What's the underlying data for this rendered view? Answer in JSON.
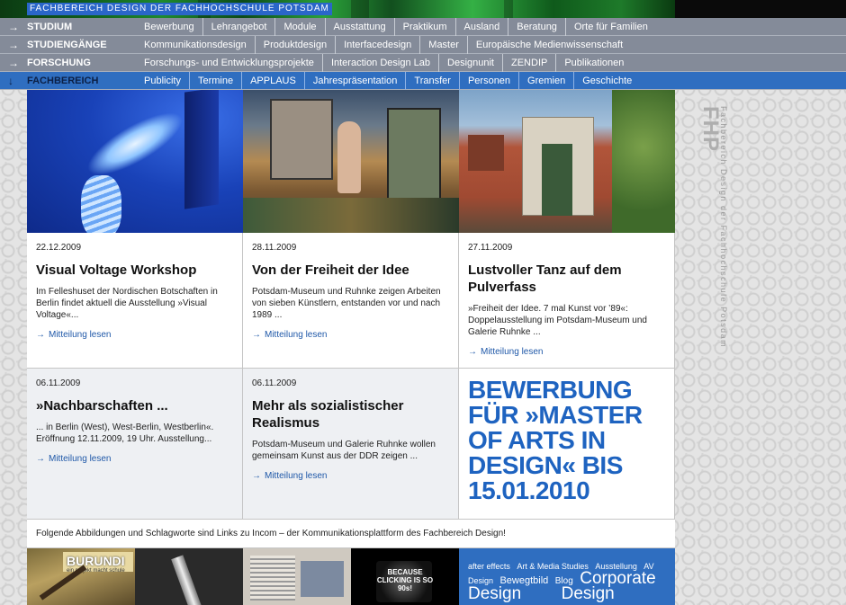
{
  "site": {
    "title": "FACHBEREICH DESIGN DER FACHHOCHSCHULE POTSDAM"
  },
  "nav": [
    {
      "arrow": "→",
      "section": "STUDIUM",
      "links": [
        "Bewerbung",
        "Lehrangebot",
        "Module",
        "Ausstattung",
        "Praktikum",
        "Ausland",
        "Beratung",
        "Orte für Familien"
      ]
    },
    {
      "arrow": "→",
      "section": "STUDIENGÄNGE",
      "links": [
        "Kommunikationsdesign",
        "Produktdesign",
        "Interfacedesign",
        "Master",
        "Europäische Medienwissenschaft"
      ]
    },
    {
      "arrow": "→",
      "section": "FORSCHUNG",
      "links": [
        "Forschungs- und Entwicklungsprojekte",
        "Interaction Design Lab",
        "Designunit",
        "ZENDIP",
        "Publikationen"
      ]
    },
    {
      "arrow": "↓",
      "section": "FACHBEREICH",
      "links": [
        "Publicity",
        "Termine",
        "APPLAUS",
        "Jahrespräsentation",
        "Transfer",
        "Personen",
        "Gremien",
        "Geschichte"
      ]
    }
  ],
  "news": [
    {
      "date": "22.12.2009",
      "title": "Visual Voltage Workshop",
      "teaser": "Im Felleshuset der Nordischen Botschaften in Berlin findet aktuell die Ausstellung »Visual Voltage«...",
      "more": "Mitteilung lesen"
    },
    {
      "date": "28.11.2009",
      "title": "Von der Freiheit der Idee",
      "teaser": "Potsdam-Museum und Ruhnke zeigen Arbeiten von sieben Künstlern, entstanden vor und nach 1989 ...",
      "more": "Mitteilung lesen"
    },
    {
      "date": "27.11.2009",
      "title": "Lustvoller Tanz auf dem Pulverfass",
      "teaser": "»Freiheit der Idee. 7 mal Kunst vor ’89«: Doppelausstellung im Potsdam-Museum und Galerie Ruhnke ...",
      "more": "Mitteilung lesen"
    },
    {
      "date": "06.11.2009",
      "title": "»Nachbarschaften ...",
      "teaser": "... in Berlin (West), West-Berlin, Westberlin«. Eröffnung 12.11.2009, 19 Uhr. Ausstellung...",
      "more": "Mitteilung lesen"
    },
    {
      "date": "06.11.2009",
      "title": "Mehr als sozialistischer Realismus",
      "teaser": "Potsdam-Museum und Galerie Ruhnke wollen gemeinsam Kunst aus der DDR zeigen ...",
      "more": "Mitteilung lesen"
    }
  ],
  "promo": {
    "text": "BEWERBUNG FÜR »MASTER OF ARTS IN DESIGN« BIS 15.01.2010"
  },
  "linkbar": {
    "text": "Folgende Abbildungen und Schlagworte sind Links zu Incom – der Kommunikationsplattform des Fachbereich Design!"
  },
  "thumbs": [
    {
      "caption": "BURUNDI",
      "sub": "ein projekt macht schule"
    },
    {
      "caption": ""
    },
    {
      "caption": ""
    },
    {
      "caption": "BECAUSE CLICKING IS SO 90s!"
    }
  ],
  "tags": [
    {
      "label": "after effects",
      "size": 9
    },
    {
      "label": "Art & Media Studies",
      "size": 9
    },
    {
      "label": "Ausstellung",
      "size": 9
    },
    {
      "label": "AV",
      "size": 9
    },
    {
      "label": "Design",
      "size": 9
    },
    {
      "label": "Bewegtbild",
      "size": 11
    },
    {
      "label": "Blog",
      "size": 10
    },
    {
      "label": "Corporate",
      "size": 19
    },
    {
      "label": "Design",
      "size": 19
    },
    {
      "label": "Design",
      "size": 19
    }
  ],
  "brand": {
    "logo": "FHP",
    "sub": "Fachbereich Design der Fachhochschule Potsdam"
  }
}
